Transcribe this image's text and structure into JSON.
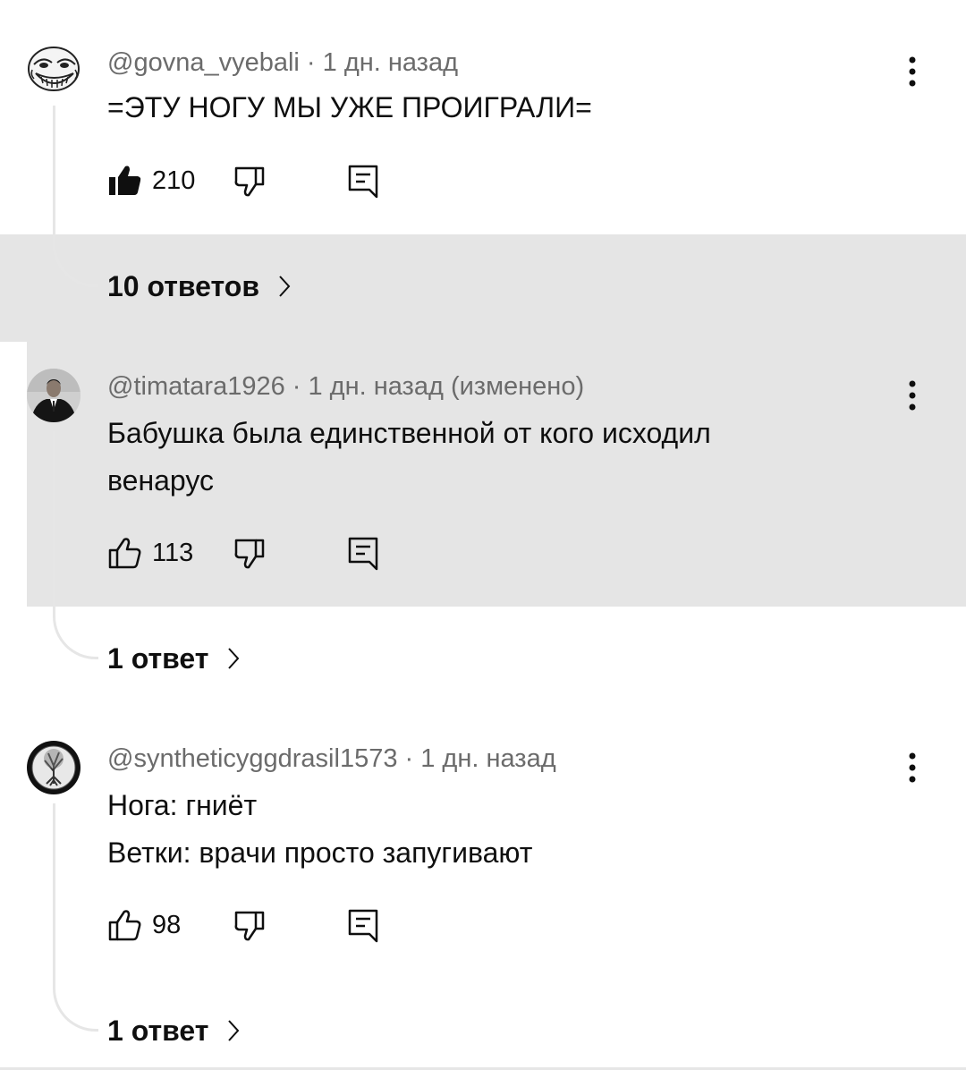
{
  "comments": [
    {
      "author": "@govna_vyebali",
      "meta_suffix": " · 1 дн. назад",
      "text": "=ЭТУ НОГУ МЫ УЖЕ ПРОИГРАЛИ=",
      "likes": "210",
      "liked": true,
      "avatar_icon": "trollface-avatar",
      "replies_label": "10 ответов"
    },
    {
      "author": "@timatara1926",
      "meta_suffix": " · 1 дн. назад (изменено)",
      "text": "Бабушка была единственной от кого исходил\nвенарус",
      "likes": "113",
      "liked": false,
      "avatar_icon": "person-in-suit-avatar",
      "replies_label": "1 ответ"
    },
    {
      "author": "@syntheticyggdrasil1573",
      "meta_suffix": " · 1 дн. назад",
      "text": "Нога: гниёт\nВетки: врачи просто запугивают",
      "likes": "98",
      "liked": false,
      "avatar_icon": "tree-avatar",
      "replies_label": "1 ответ"
    }
  ],
  "colors": {
    "highlight": "#e5e5e5",
    "meta_text": "#6b6b6b",
    "primary_text": "#0f0f0f",
    "thread_line": "#e6e6e6"
  }
}
